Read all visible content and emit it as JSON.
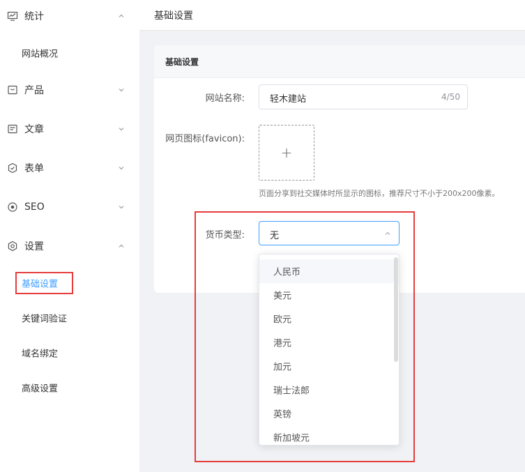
{
  "sidebar": {
    "groups": [
      {
        "label": "统计",
        "icon": "chart-icon",
        "expanded": true
      },
      {
        "label": "产品",
        "icon": "product-icon",
        "expanded": false
      },
      {
        "label": "文章",
        "icon": "article-icon",
        "expanded": false
      },
      {
        "label": "表单",
        "icon": "form-icon",
        "expanded": false
      },
      {
        "label": "SEO",
        "icon": "seo-icon",
        "expanded": false
      },
      {
        "label": "设置",
        "icon": "settings-icon",
        "expanded": true
      }
    ],
    "stats_sub": [
      "网站概况"
    ],
    "settings_sub": [
      "基础设置",
      "关键词验证",
      "域名绑定",
      "高级设置"
    ],
    "active_color": "#409eff"
  },
  "header": {
    "title": "基础设置"
  },
  "card": {
    "title": "基础设置"
  },
  "form": {
    "site_name": {
      "label": "网站名称:",
      "value": "轻木建站",
      "count": "4/50"
    },
    "favicon": {
      "label": "网页图标(favicon):",
      "plus": "+",
      "hint": "页面分享到社交媒体时所显示的图标，推荐尺寸不小于200x200像素。"
    },
    "currency": {
      "label": "货币类型:",
      "value": "无"
    }
  },
  "dropdown": {
    "options": [
      "人民币",
      "美元",
      "欧元",
      "港元",
      "加元",
      "瑞士法郎",
      "英镑",
      "新加坡元"
    ],
    "hovered": "人民币"
  },
  "colors": {
    "highlight": "#e63c3c",
    "primary": "#409eff"
  }
}
